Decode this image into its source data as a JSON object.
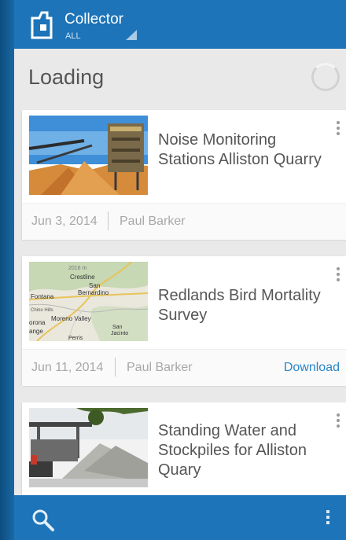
{
  "app": {
    "title": "Collector",
    "subtitle": "ALL",
    "icons": {
      "menu": "hamburger-icon",
      "app": "collector-app-icon",
      "dropdown": "dropdown-corner-icon"
    }
  },
  "status": {
    "title": "Loading"
  },
  "maps": [
    {
      "title": "Noise Monitoring Stations Alliston Quarry",
      "date": "Jun 3, 2014",
      "owner": "Paul Barker",
      "action": ""
    },
    {
      "title": "Redlands Bird Mortality Survey",
      "date": "Jun 11, 2014",
      "owner": "Paul Barker",
      "action": "Download",
      "thumbnail_labels": [
        "Crestline",
        "San Bernardino",
        "Fontana",
        "Chino Hills",
        "Moreno Valley",
        "orona",
        "ange",
        "San Jacinto",
        "Perris",
        "2016 m"
      ]
    },
    {
      "title": "Standing Water and Stockpiles for Alliston Quary",
      "date": "",
      "owner": "",
      "action": ""
    }
  ],
  "bottombar": {
    "icons": {
      "search": "search-icon",
      "more": "overflow-menu-icon"
    }
  },
  "colors": {
    "primary": "#1d74b8",
    "background": "#e9e9e9",
    "card": "#ffffff",
    "link": "#2a86c8",
    "muted": "#a8a8a8"
  }
}
